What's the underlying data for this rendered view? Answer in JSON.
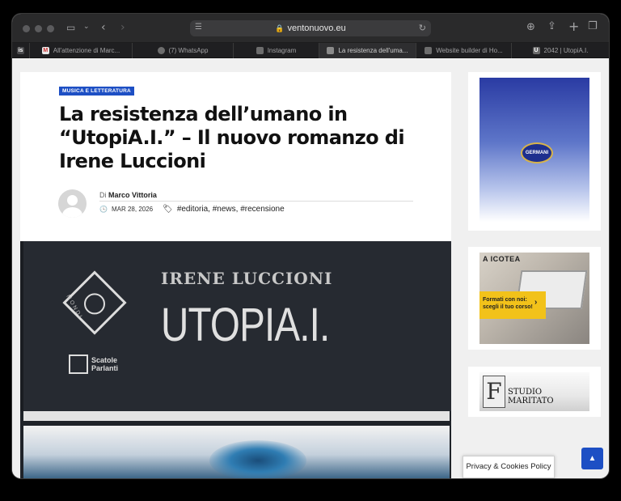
{
  "browser": {
    "url": "ventonuovo.eu",
    "tabs": [
      {
        "label": "",
        "icon": "is-favicon"
      },
      {
        "label": "All'attenzione di Marc...",
        "icon": "gmail-icon"
      },
      {
        "label": "(7) WhatsApp",
        "icon": "whatsapp-icon"
      },
      {
        "label": "Instagram",
        "icon": "instagram-icon"
      },
      {
        "label": "La resistenza dell'uma...",
        "icon": "ventonuovo-icon"
      },
      {
        "label": "Website builder di Ho...",
        "icon": "hostinger-icon"
      },
      {
        "label": "2042 | UtopiA.I.",
        "icon": "utopia-icon"
      }
    ]
  },
  "article": {
    "category": "MUSICA E LETTERATURA",
    "title": "La resistenza dell’umano in “UtopiA.I.” – Il nuovo romanzo di Irene Luccioni",
    "by_prefix": "Di",
    "author": "Marco Vittoria",
    "date": "MAR 28, 2026",
    "tags": "#editoria, #news, #recensione"
  },
  "cover": {
    "author_name": "IRENE LUCCIONI",
    "book_title": "UTOPIA.I.",
    "publisher_logo": "MONDI",
    "imprint": "Scatole Parlanti"
  },
  "sidebar": {
    "ad1": {
      "seal": "GERMANI"
    },
    "ad2": {
      "brand": "A ICOTEA",
      "cta": "Formati con noi: scegli il tuo corso!"
    },
    "ad3": {
      "brand": "STUDIO MARITATO",
      "initial": "F"
    }
  },
  "footer": {
    "cookie_label": "Privacy & Cookies Policy",
    "scroll_top": "▲"
  },
  "colors": {
    "accent": "#1d4fc4"
  }
}
